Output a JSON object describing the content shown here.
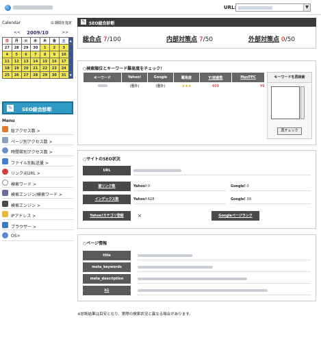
{
  "header": {
    "url_label": "URL:",
    "dropdown_arrow": "▼"
  },
  "calendar": {
    "label": "Calendar",
    "back_link": "⊟ 期間を指定",
    "prev": "<<",
    "month": "2009/10",
    "next": ">>",
    "weekdays": [
      "日",
      "月",
      "火",
      "水",
      "木",
      "金",
      "土"
    ],
    "weeks": [
      [
        "27",
        "28",
        "29",
        "30",
        "1",
        "2",
        "3"
      ],
      [
        "4",
        "5",
        "6",
        "7",
        "8",
        "9",
        "10"
      ],
      [
        "11",
        "12",
        "13",
        "14",
        "15",
        "16",
        "17"
      ],
      [
        "18",
        "19",
        "20",
        "21",
        "22",
        "23",
        "24"
      ],
      [
        "25",
        "26",
        "27",
        "28",
        "29",
        "30",
        "31"
      ]
    ]
  },
  "sidebar": {
    "seo_button_label": "SEO総合診断",
    "menu_title": "Menu",
    "items": [
      {
        "label": "総アクセス数 >",
        "icon": "bar-chart-icon",
        "color": "#e07a2e"
      },
      {
        "label": "ページ別アクセス数 >",
        "icon": "page-icon",
        "color": "#8aa0b8"
      },
      {
        "label": "時間帯別アクセス数 >",
        "icon": "clock-icon",
        "color": "#6c8fc9"
      },
      {
        "label": "ファイル別転送量 >",
        "icon": "file-icon",
        "color": "#3f7fcf"
      },
      {
        "label": "リンク元URL >",
        "icon": "globe-icon",
        "color": "#d04040"
      },
      {
        "label": "検索ワード >",
        "icon": "search-icon",
        "color": "#888888"
      },
      {
        "label": "検索エンジン/検索ワード >",
        "icon": "engine-icon",
        "color": "#6b6b9b"
      },
      {
        "label": "検索エンジン >",
        "icon": "engine-icon",
        "color": "#4a4a4a"
      },
      {
        "label": "IPアドレス >",
        "icon": "ip-icon",
        "color": "#e8b840"
      },
      {
        "label": "ブラウザー >",
        "icon": "browser-icon",
        "color": "#3a78c0"
      },
      {
        "label": "OS>",
        "icon": "os-icon",
        "color": "#5a8ad0"
      }
    ]
  },
  "seo": {
    "bar_title": "SEO総合診断",
    "pen_icon": "✎",
    "total_label": "総合点",
    "total_value": "7",
    "total_max": "/100",
    "internal_label": "内部対策点",
    "internal_value": "7",
    "internal_max": "/50",
    "external_label": "外部対策点",
    "external_value": "0",
    "external_max": "/50"
  },
  "keyword_box": {
    "title": "○検索順位とキーワード難易度をチェック！",
    "headers": [
      "キーワード",
      "Yahoo!",
      "Google",
      "難易度",
      "Y!検索数",
      "MaxPPC"
    ],
    "row": {
      "yahoo": "(圏外)",
      "google": "(圏外)",
      "difficulty": "★★★",
      "searches": "609",
      "maxppc": "¥9"
    },
    "side_title": "キーワードを再検索",
    "recheck_button": "再チェック"
  },
  "site_box": {
    "title": "○サイトのSEO状況",
    "url_label": "URL",
    "backlinks_label": "被リンク数",
    "backlinks_yahoo": "Yahoo!",
    "backlinks_yahoo_val": "0",
    "backlinks_google": "Google!",
    "backlinks_google_val": "0",
    "index_label": "インデックス数",
    "index_yahoo": "Yahoo!",
    "index_yahoo_val": "628",
    "index_google": "Google!",
    "index_google_val": "39",
    "yahoo_cat_label": "Yahoo!カテゴリ登録",
    "yahoo_cat_val": "×",
    "pagerank_label": "Googleページランク"
  },
  "page_box": {
    "title": "○ページ情報",
    "rows": [
      "title",
      "meta_keywords",
      "meta_description",
      "h1"
    ]
  },
  "note": "※診断結果は目安となり、実際の検索状況と異なる場合があります。",
  "colors": {
    "bar": "#3a3a3a",
    "accent_red": "#cc0000",
    "seo_button": "#2f9bc4",
    "calendar_highlight": "#f2e64a"
  }
}
